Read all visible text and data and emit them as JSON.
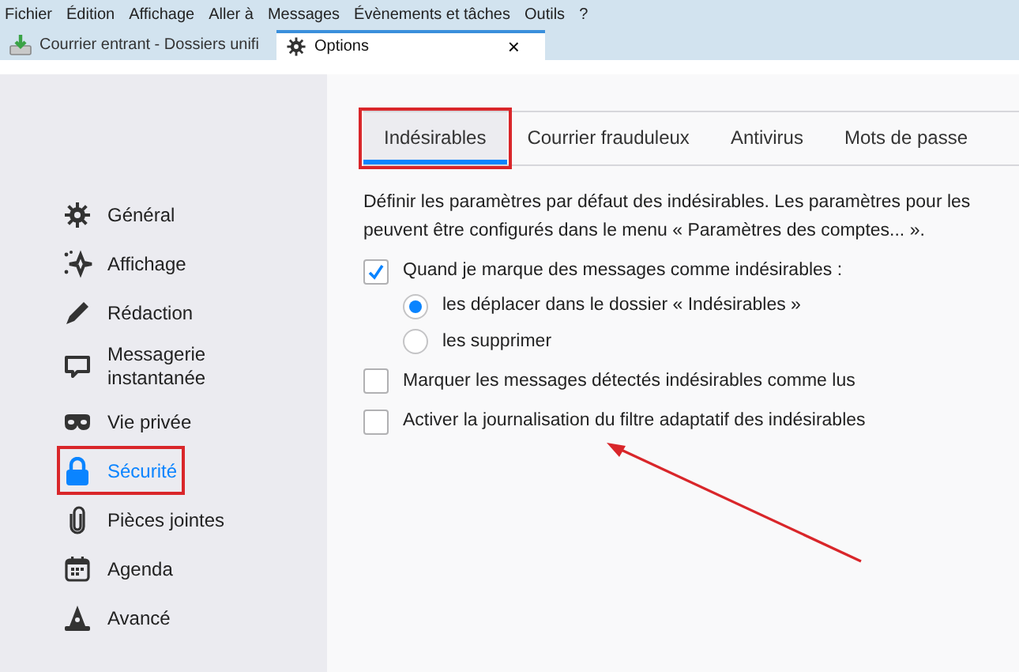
{
  "menu_bar": [
    "Fichier",
    "Édition",
    "Affichage",
    "Aller à",
    "Messages",
    "Évènements et tâches",
    "Outils",
    "?"
  ],
  "tabs": [
    {
      "label": "Courrier entrant - Dossiers unifi",
      "kind": "mail",
      "selected": false
    },
    {
      "label": "Options",
      "kind": "settings",
      "selected": true,
      "close": "×"
    }
  ],
  "sidebar": {
    "items": [
      {
        "label": "Général",
        "selected": false,
        "highlighted": false
      },
      {
        "label": "Affichage",
        "selected": false,
        "highlighted": false
      },
      {
        "label": "Rédaction",
        "selected": false,
        "highlighted": false
      },
      {
        "label": "Messagerie instantanée",
        "selected": false,
        "highlighted": false
      },
      {
        "label": "Vie privée",
        "selected": false,
        "highlighted": false
      },
      {
        "label": "Sécurité",
        "selected": true,
        "highlighted": true
      },
      {
        "label": "Pièces jointes",
        "selected": false,
        "highlighted": false
      },
      {
        "label": "Agenda",
        "selected": false,
        "highlighted": false
      },
      {
        "label": "Avancé",
        "selected": false,
        "highlighted": false
      }
    ]
  },
  "subtabs": [
    {
      "label": "Indésirables",
      "selected": true,
      "highlighted": true
    },
    {
      "label": "Courrier frauduleux",
      "selected": false,
      "highlighted": false
    },
    {
      "label": "Antivirus",
      "selected": false,
      "highlighted": false
    },
    {
      "label": "Mots de passe",
      "selected": false,
      "highlighted": false
    }
  ],
  "description": [
    "Définir les paramètres par défaut des indésirables. Les paramètres pour les",
    "peuvent être configurés dans le menu « Paramètres des comptes... »."
  ],
  "options": [
    {
      "kind": "checkbox",
      "label": "Quand je marque des messages comme indésirables :",
      "checked": true,
      "children": [
        {
          "kind": "radio",
          "label": "les déplacer dans le dossier « Indésirables »",
          "checked": true
        },
        {
          "kind": "radio",
          "label": "les supprimer",
          "checked": false
        }
      ]
    },
    {
      "kind": "checkbox",
      "label": "Marquer les messages détectés indésirables comme lus",
      "checked": false
    },
    {
      "kind": "checkbox",
      "label": "Activer la journalisation du filtre adaptatif des indésirables",
      "checked": false
    }
  ],
  "annotations": [
    {
      "kind": "arrow"
    }
  ]
}
